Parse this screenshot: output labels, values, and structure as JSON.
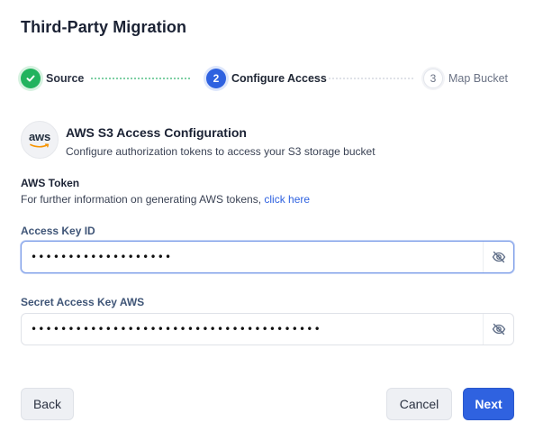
{
  "page": {
    "title": "Third-Party Migration"
  },
  "stepper": {
    "steps": [
      {
        "number": "",
        "label": "Source",
        "state": "complete"
      },
      {
        "number": "2",
        "label": "Configure Access",
        "state": "active"
      },
      {
        "number": "3",
        "label": "Map Bucket",
        "state": "pending"
      }
    ]
  },
  "section": {
    "logo_text": "aws",
    "title": "AWS S3 Access Configuration",
    "subtitle": "Configure authorization tokens to access your S3 storage bucket"
  },
  "token": {
    "label": "AWS Token",
    "info_text": "For further information on generating AWS tokens, ",
    "link_text": "click here"
  },
  "fields": {
    "access_key": {
      "label": "Access Key ID",
      "value": "•••••••••••••••••••"
    },
    "secret_key": {
      "label": "Secret Access Key AWS",
      "value": "•••••••••••••••••••••••••••••••••••••••"
    }
  },
  "buttons": {
    "back": "Back",
    "cancel": "Cancel",
    "next": "Next"
  },
  "colors": {
    "primary": "#2f62e0",
    "success": "#22b35e"
  },
  "icons": {
    "complete": "check-icon",
    "toggle_visibility": "eye-off-icon"
  }
}
